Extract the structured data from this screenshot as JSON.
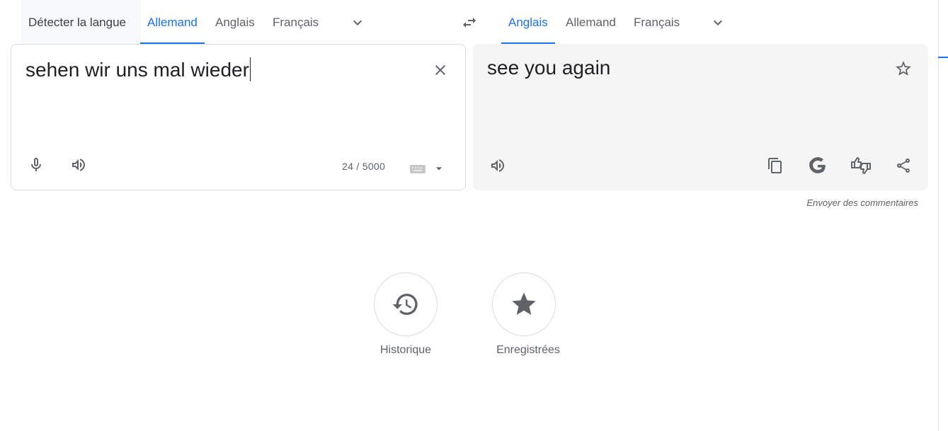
{
  "source_tabs": {
    "detect": "Détecter la langue",
    "lang1": "Allemand",
    "lang2": "Anglais",
    "lang3": "Français"
  },
  "target_tabs": {
    "lang1": "Anglais",
    "lang2": "Allemand",
    "lang3": "Français"
  },
  "source": {
    "text": "sehen wir uns mal wieder",
    "counter": "24 / 5000"
  },
  "target": {
    "text": "see you again"
  },
  "feedback_link": "Envoyer des commentaires",
  "shortcuts": {
    "history": "Historique",
    "saved": "Enregistrées"
  },
  "colors": {
    "accent": "#1a73e8",
    "icon": "#5f6368"
  },
  "icons": [
    "chevron-down-icon",
    "swap-languages-icon",
    "close-icon",
    "microphone-icon",
    "speaker-icon",
    "keyboard-icon",
    "star-outline-icon",
    "copy-icon",
    "google-g-icon",
    "feedback-thumbs-icon",
    "share-icon",
    "history-icon",
    "star-filled-icon"
  ]
}
